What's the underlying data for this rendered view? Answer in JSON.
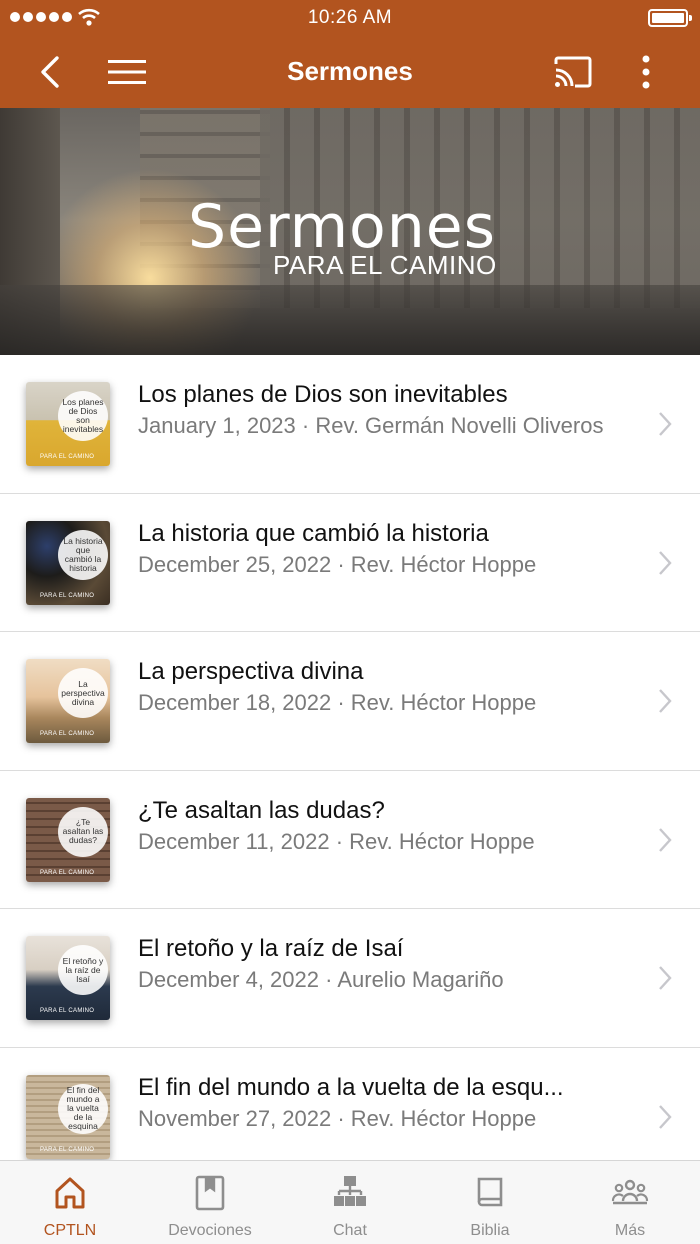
{
  "status_bar": {
    "time": "10:26 AM"
  },
  "header": {
    "title": "Sermones"
  },
  "banner": {
    "title": "Sermones",
    "subtitle": "PARA EL CAMINO"
  },
  "sermons": [
    {
      "title": "Los planes de Dios son inevitables",
      "meta": "January 1, 2023 · Rev. Germán Novelli Oliveros",
      "thumb_text": "Los planes de Dios son inevitables",
      "thumb_brand": "PARA EL CAMINO"
    },
    {
      "title": "La historia que cambió la historia",
      "meta": "December 25, 2022 · Rev. Héctor Hoppe",
      "thumb_text": "La historia que cambió la historia",
      "thumb_brand": "PARA EL CAMINO"
    },
    {
      "title": "La perspectiva divina",
      "meta": "December 18, 2022 · Rev. Héctor Hoppe",
      "thumb_text": "La perspectiva divina",
      "thumb_brand": "PARA EL CAMINO"
    },
    {
      "title": "¿Te asaltan las dudas?",
      "meta": "December 11, 2022 · Rev. Héctor Hoppe",
      "thumb_text": "¿Te asaltan las dudas?",
      "thumb_brand": "PARA EL CAMINO"
    },
    {
      "title": "El retoño y la raíz de Isaí",
      "meta": "December 4, 2022 · Aurelio Magariño",
      "thumb_text": "El retoño y la raíz de Isaí",
      "thumb_brand": "PARA EL CAMINO"
    },
    {
      "title": "El fin del mundo a la vuelta de la esqu...",
      "meta": "November 27, 2022 · Rev. Héctor Hoppe",
      "thumb_text": "El fin del mundo a la vuelta de la esquina",
      "thumb_brand": "PARA EL CAMINO"
    }
  ],
  "tabs": [
    {
      "label": "CPTLN",
      "icon": "home-icon",
      "active": true
    },
    {
      "label": "Devociones",
      "icon": "bookmark-book-icon",
      "active": false
    },
    {
      "label": "Chat",
      "icon": "chat-network-icon",
      "active": false
    },
    {
      "label": "Biblia",
      "icon": "bible-book-icon",
      "active": false
    },
    {
      "label": "Más",
      "icon": "group-icon",
      "active": false
    }
  ],
  "colors": {
    "brand": "#b2541f",
    "inactive_tab": "#8e8e8e",
    "meta_text": "#7a7a7a"
  }
}
